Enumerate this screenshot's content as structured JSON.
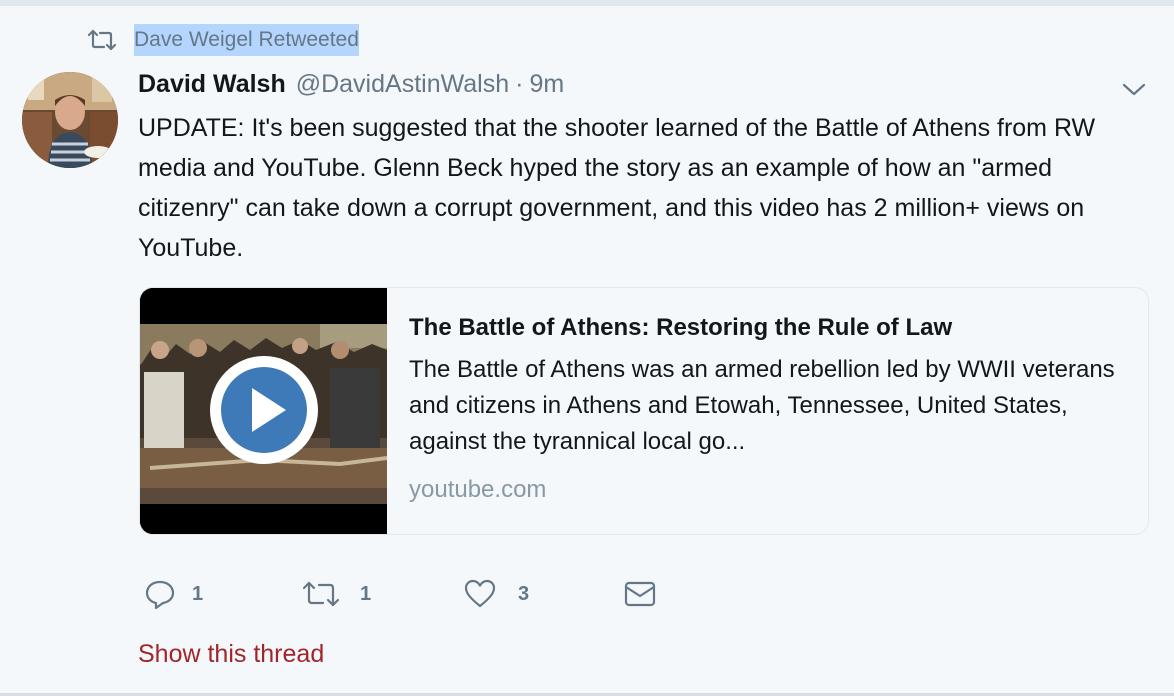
{
  "retweet_context": {
    "icon": "retweet-icon",
    "text": "Dave Weigel Retweeted"
  },
  "tweet": {
    "avatar_icon": "user-avatar",
    "name": "David Walsh",
    "handle": "@DavidAstinWalsh",
    "separator": "·",
    "time": "9m",
    "text": "UPDATE: It's been suggested that the shooter learned of the Battle of Athens from RW media and YouTube. Glenn Beck hyped the story as an example of how an \"armed citizenry\" can take down a corrupt government, and this video has 2 million+ views on YouTube.",
    "card": {
      "title": "The Battle of Athens: Restoring the Rule of Law",
      "description": "The Battle of Athens was an armed rebellion led by WWII veterans and citizens in Athens and Etowah, Tennessee, United States, against the tyrannical local go...",
      "domain": "youtube.com",
      "play_icon": "play-icon"
    },
    "actions": {
      "reply_count": "1",
      "retweet_count": "1",
      "like_count": "3"
    },
    "show_thread": "Show this thread"
  },
  "colors": {
    "background": "#f5f8fa",
    "secondary_text": "#657786",
    "selection_highlight": "#b4d5fe",
    "thread_link": "#a0262b",
    "play_button": "#3e7ab8"
  }
}
